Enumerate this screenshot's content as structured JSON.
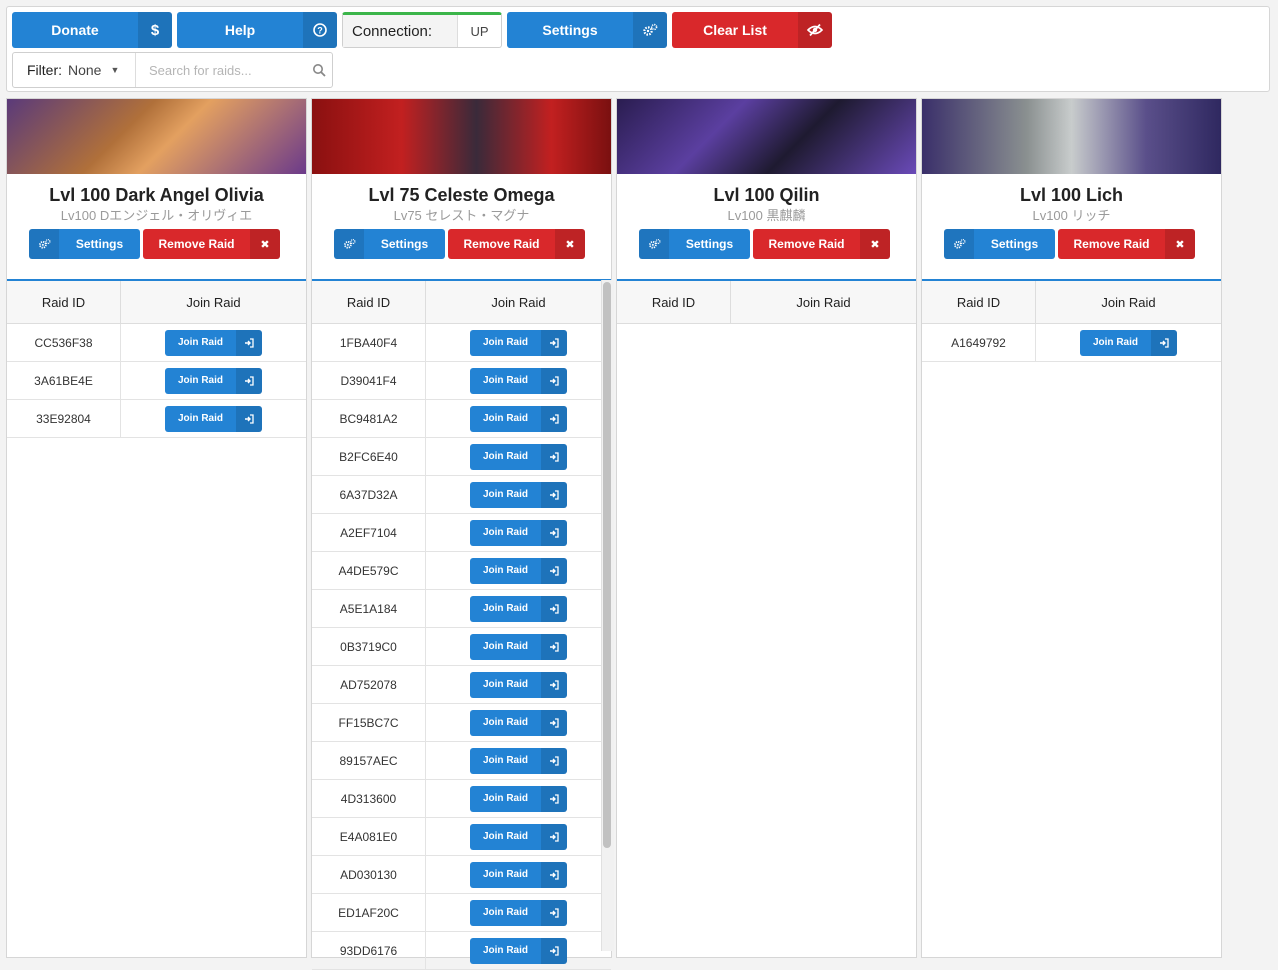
{
  "toolbar": {
    "donate_label": "Donate",
    "donate_icon": "$",
    "help_label": "Help",
    "help_icon": "?",
    "connection_label": "Connection:",
    "connection_status": "UP",
    "settings_label": "Settings",
    "clear_label": "Clear List"
  },
  "filter": {
    "label": "Filter:",
    "value": "None",
    "search_placeholder": "Search for raids..."
  },
  "colors": {
    "primary": "#2383d4",
    "danger": "#d9282b",
    "success": "#3bb54a"
  },
  "columns": [
    {
      "title": "Lvl 100 Dark Angel Olivia",
      "subtitle": "Lv100 Dエンジェル・オリヴィエ",
      "settings_label": "Settings",
      "remove_label": "Remove Raid",
      "header_id": "Raid ID",
      "header_join": "Join Raid",
      "rows": [
        "CC536F38",
        "3A61BE4E",
        "33E92804"
      ]
    },
    {
      "title": "Lvl 75 Celeste Omega",
      "subtitle": "Lv75 セレスト・マグナ",
      "settings_label": "Settings",
      "remove_label": "Remove Raid",
      "header_id": "Raid ID",
      "header_join": "Join Raid",
      "rows": [
        "1FBA40F4",
        "D39041F4",
        "BC9481A2",
        "B2FC6E40",
        "6A37D32A",
        "A2EF7104",
        "A4DE579C",
        "A5E1A184",
        "0B3719C0",
        "AD752078",
        "FF15BC7C",
        "89157AEC",
        "4D313600",
        "E4A081E0",
        "AD030130",
        "ED1AF20C",
        "93DD6176"
      ]
    },
    {
      "title": "Lvl 100 Qilin",
      "subtitle": "Lv100 黒麒麟",
      "settings_label": "Settings",
      "remove_label": "Remove Raid",
      "header_id": "Raid ID",
      "header_join": "Join Raid",
      "rows": []
    },
    {
      "title": "Lvl 100 Lich",
      "subtitle": "Lv100 リッチ",
      "settings_label": "Settings",
      "remove_label": "Remove Raid",
      "header_id": "Raid ID",
      "header_join": "Join Raid",
      "rows": [
        "A1649792"
      ]
    }
  ],
  "join_label": "Join Raid"
}
